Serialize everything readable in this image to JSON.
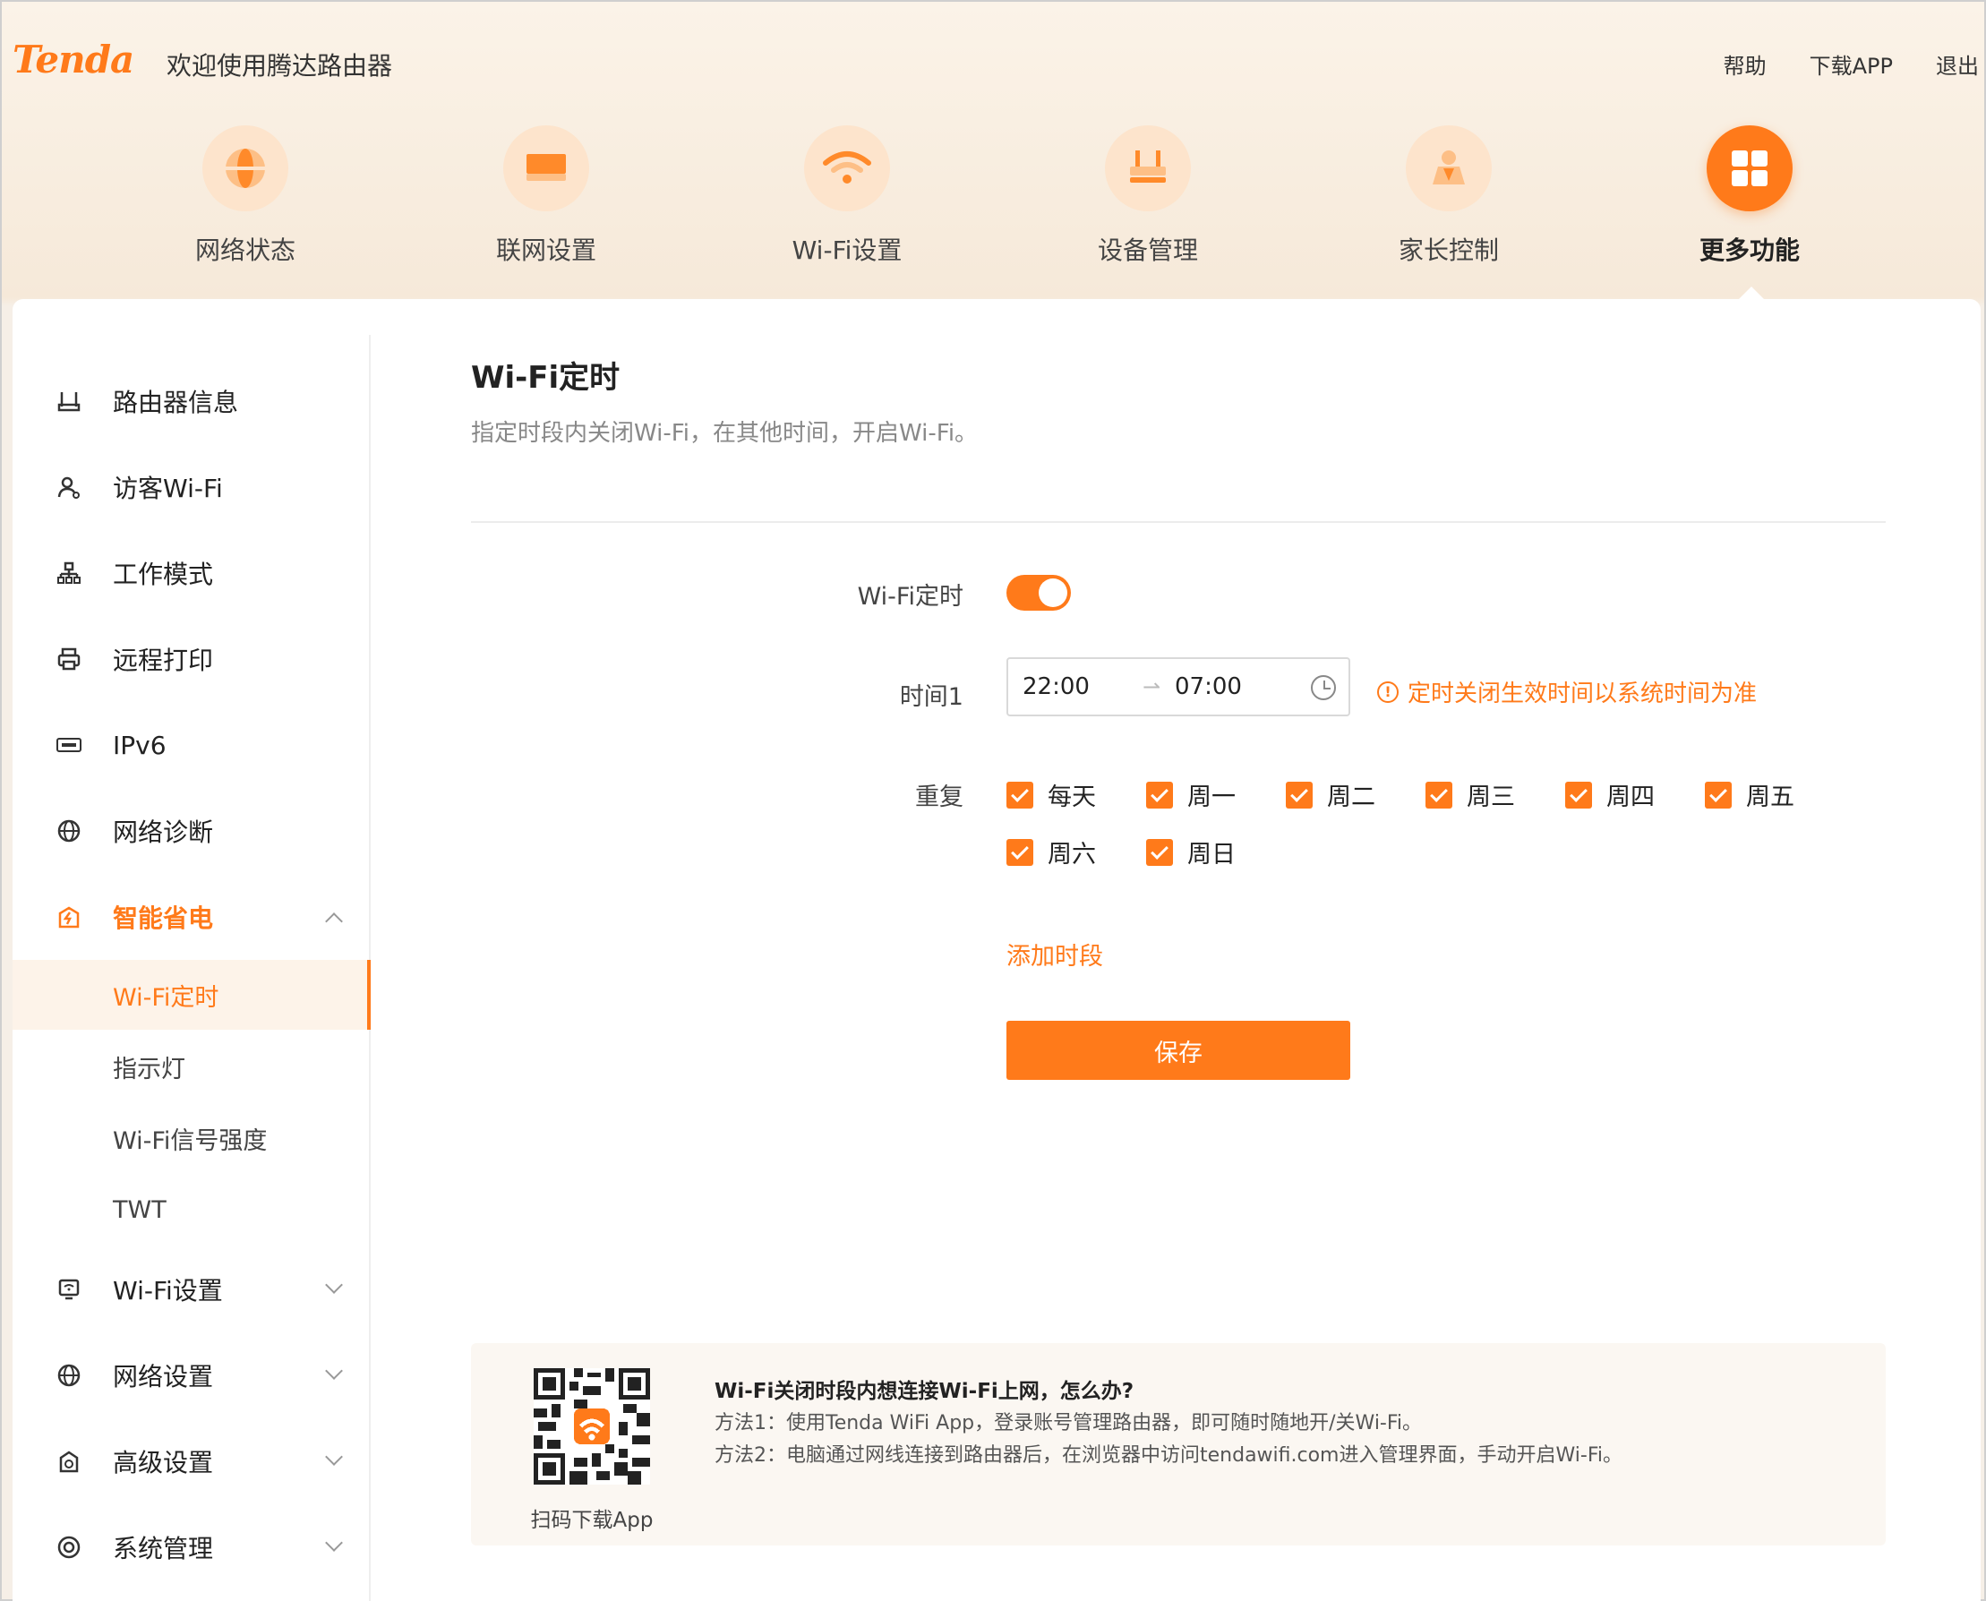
{
  "header": {
    "logo": "Tenda",
    "welcome": "欢迎使用腾达路由器",
    "links": [
      "帮助",
      "下载APP",
      "退出"
    ]
  },
  "nav": [
    {
      "label": "网络状态",
      "icon": "globe-icon"
    },
    {
      "label": "联网设置",
      "icon": "monitor-icon"
    },
    {
      "label": "Wi-Fi设置",
      "icon": "wifi-icon"
    },
    {
      "label": "设备管理",
      "icon": "router-icon"
    },
    {
      "label": "家长控制",
      "icon": "parent-icon"
    },
    {
      "label": "更多功能",
      "icon": "grid-icon",
      "active": true
    }
  ],
  "sidebar": {
    "items": [
      {
        "label": "路由器信息",
        "icon": "router-info-icon"
      },
      {
        "label": "访客Wi-Fi",
        "icon": "guest-icon"
      },
      {
        "label": "工作模式",
        "icon": "work-mode-icon"
      },
      {
        "label": "远程打印",
        "icon": "printer-icon"
      },
      {
        "label": "IPv6",
        "icon": "ipv6-icon"
      },
      {
        "label": "网络诊断",
        "icon": "diagnose-icon"
      },
      {
        "label": "智能省电",
        "icon": "power-save-icon",
        "open": true
      },
      {
        "label": "Wi-Fi设置",
        "icon": "wifi-settings-icon"
      },
      {
        "label": "网络设置",
        "icon": "network-settings-icon"
      },
      {
        "label": "高级设置",
        "icon": "advanced-icon"
      },
      {
        "label": "系统管理",
        "icon": "system-icon"
      }
    ],
    "sub_items": [
      "Wi-Fi定时",
      "指示灯",
      "Wi-Fi信号强度",
      "TWT"
    ],
    "active_sub": "Wi-Fi定时"
  },
  "main": {
    "title": "Wi-Fi定时",
    "subtitle": "指定时段内关闭Wi-Fi，在其他时间，开启Wi-Fi。",
    "toggle_label": "Wi-Fi定时",
    "toggle_on": true,
    "time_label": "时间1",
    "time_start": "22:00",
    "time_arrow": "⇀",
    "time_end": "07:00",
    "warning": "定时关闭生效时间以系统时间为准",
    "repeat_label": "重复",
    "days": [
      "每天",
      "周一",
      "周二",
      "周三",
      "周四",
      "周五",
      "周六",
      "周日"
    ],
    "add_period": "添加时段",
    "save": "保存"
  },
  "help": {
    "qr_label": "扫码下载App",
    "title": "Wi-Fi关闭时段内想连接Wi-Fi上网，怎么办?",
    "method1": "方法1：使用Tenda WiFi App，登录账号管理路由器，即可随时随地开/关Wi-Fi。",
    "method2": "方法2：电脑通过网线连接到路由器后，在浏览器中访问tendawifi.com进入管理界面，手动开启Wi-Fi。"
  },
  "colors": {
    "accent": "#ff7a1a",
    "nav_circle": "#fde4cc"
  }
}
